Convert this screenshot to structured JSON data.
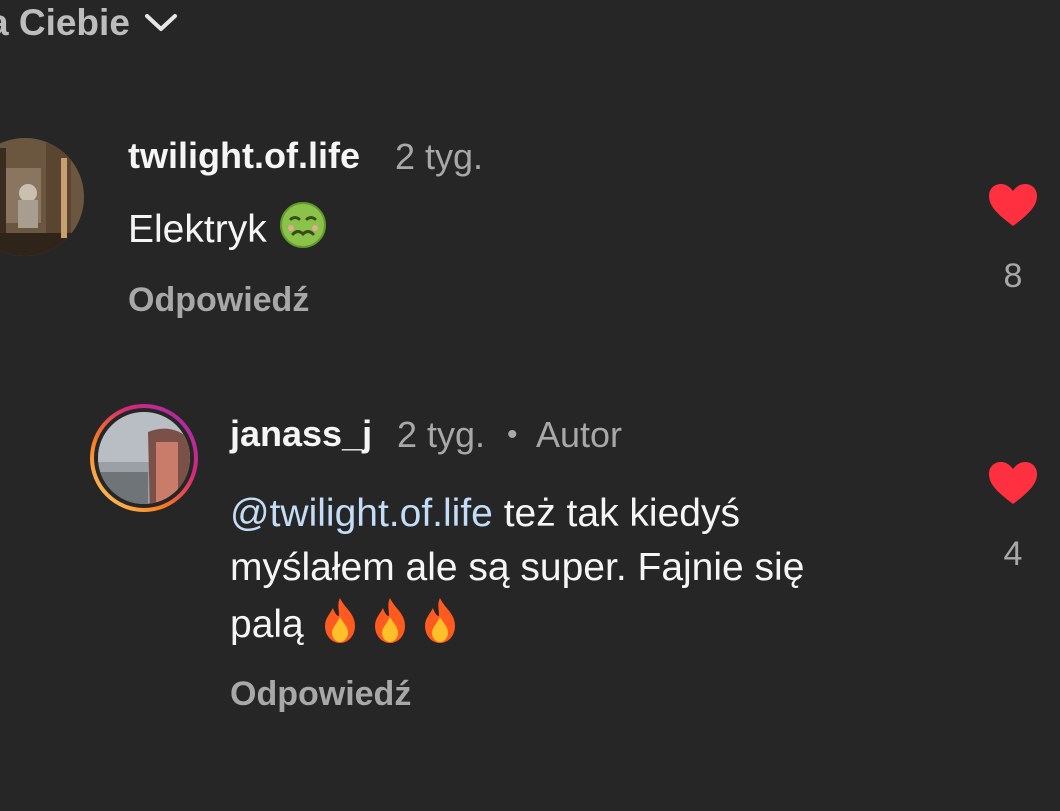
{
  "sort": {
    "label": "a Ciebie",
    "icon": "chevron-down-icon"
  },
  "comments": [
    {
      "username": "twilight.of.life",
      "time": "2 tyg.",
      "text": "Elektryk",
      "emoji": "nauseated-face-emoji",
      "reply_label": "Odpowiedź",
      "likes": "8",
      "liked": true
    },
    {
      "username": "janass_j",
      "time": "2 tyg.",
      "separator": "•",
      "author_tag": "Autor",
      "mention": "@twilight.of.life",
      "text_line1": " też tak kiedyś",
      "text_line2": "myślałem ale są super. Fajnie się",
      "text_line3": "palą",
      "emoji": "fire-emoji",
      "reply_label": "Odpowiedź",
      "likes": "4",
      "liked": true,
      "has_story_ring": true
    }
  ],
  "colors": {
    "background": "#262626",
    "heart": "#ff3040",
    "mention": "#c3dcf7",
    "secondary_text": "#a8a8a8"
  }
}
